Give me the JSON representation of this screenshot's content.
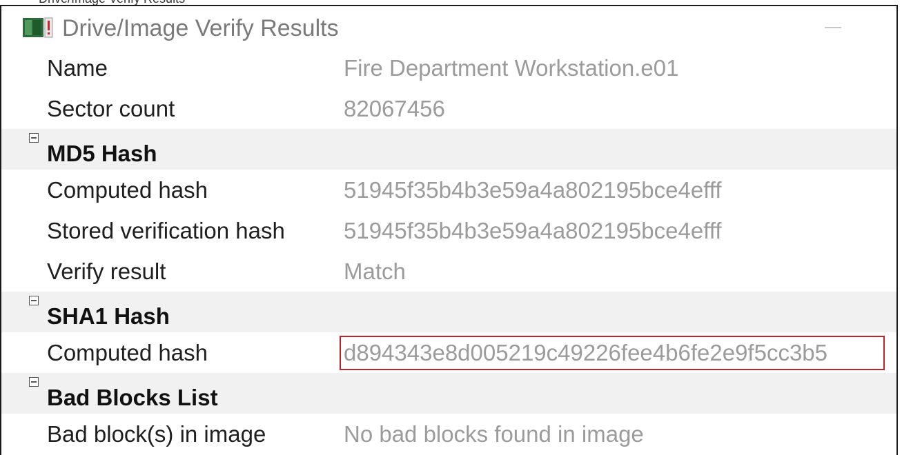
{
  "window": {
    "top_strip_text": "Drive/Image Verify Results",
    "title": "Drive/Image Verify Results"
  },
  "rows": {
    "name": {
      "label": "Name",
      "value": "Fire Department Workstation.e01"
    },
    "sector_count": {
      "label": "Sector count",
      "value": "82067456"
    },
    "md5": {
      "label": "MD5 Hash"
    },
    "md5_computed": {
      "label": "Computed hash",
      "value": "51945f35b4b3e59a4a802195bce4efff"
    },
    "md5_stored": {
      "label": "Stored verification hash",
      "value": "51945f35b4b3e59a4a802195bce4efff"
    },
    "verify_result": {
      "label": "Verify result",
      "value": "Match"
    },
    "sha1": {
      "label": "SHA1 Hash"
    },
    "sha1_computed": {
      "label": "Computed hash",
      "value": "d894343e8d005219c49226fee4b6fe2e9f5cc3b5"
    },
    "bad_blocks": {
      "label": "Bad Blocks List"
    },
    "bad_blocks_in_image": {
      "label": "Bad block(s) in image",
      "value": "No bad blocks found in image"
    }
  },
  "colors": {
    "highlight_border": "#c0202a",
    "category_background": "#f1f1f1",
    "value_text": "#9b9b9b"
  },
  "icons": {
    "app": "drive-image-icon",
    "minimize": "minimize-icon",
    "collapse": "collapse-minus-icon"
  }
}
